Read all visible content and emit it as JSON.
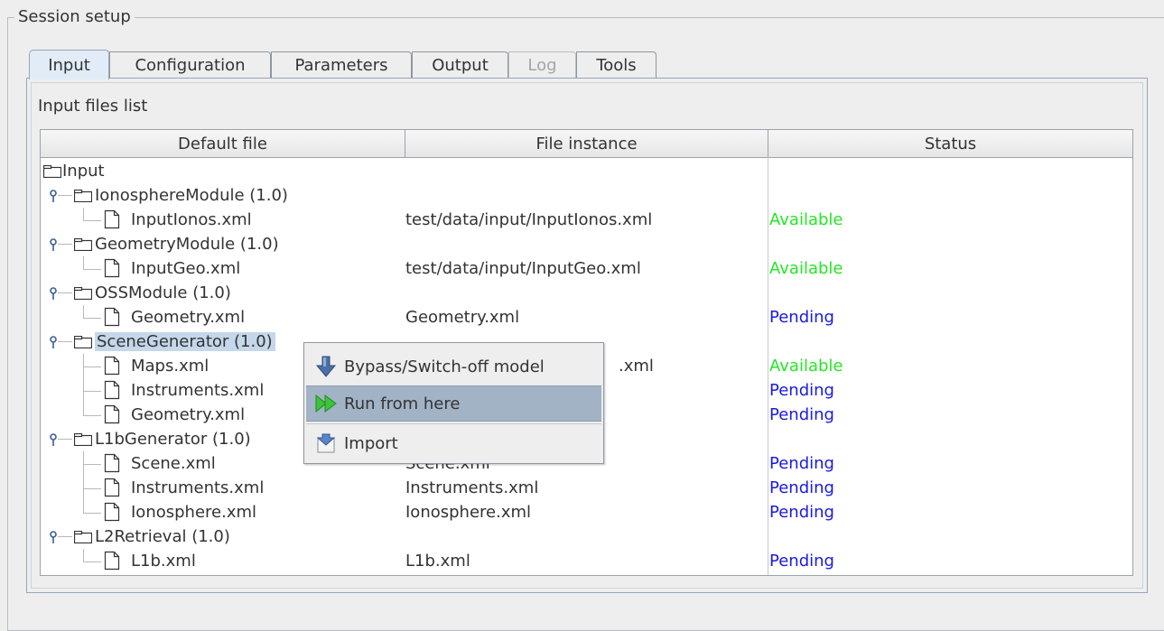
{
  "group": {
    "title": "Session setup"
  },
  "tabs": [
    {
      "label": "Input",
      "selected": true,
      "enabled": true
    },
    {
      "label": "Configuration",
      "selected": false,
      "enabled": true
    },
    {
      "label": "Parameters",
      "selected": false,
      "enabled": true
    },
    {
      "label": "Output",
      "selected": false,
      "enabled": true
    },
    {
      "label": "Log",
      "selected": false,
      "enabled": false
    },
    {
      "label": "Tools",
      "selected": false,
      "enabled": true
    }
  ],
  "input_panel": {
    "label": "Input files list",
    "columns": [
      "Default file",
      "File instance",
      "Status"
    ],
    "status_colors": {
      "Available": "#26e526",
      "Pending": "#1a1ae0"
    },
    "rows": [
      {
        "kind": "root",
        "file": "Input",
        "instance": "",
        "status": ""
      },
      {
        "kind": "module",
        "file": "IonosphereModule (1.0)",
        "instance": "",
        "status": ""
      },
      {
        "kind": "file",
        "file": "InputIonos.xml",
        "instance": "test/data/input/InputIonos.xml",
        "status": "Available"
      },
      {
        "kind": "module",
        "file": "GeometryModule (1.0)",
        "instance": "",
        "status": ""
      },
      {
        "kind": "file",
        "file": "InputGeo.xml",
        "instance": "test/data/input/InputGeo.xml",
        "status": "Available"
      },
      {
        "kind": "module",
        "file": "OSSModule (1.0)",
        "instance": "",
        "status": ""
      },
      {
        "kind": "file",
        "file": "Geometry.xml",
        "instance": "Geometry.xml",
        "status": "Pending"
      },
      {
        "kind": "module",
        "file": "SceneGenerator (1.0)",
        "instance": "",
        "status": "",
        "selected": true
      },
      {
        "kind": "file",
        "file": "Maps.xml",
        "instance": ".xml",
        "status": "Available"
      },
      {
        "kind": "file",
        "file": "Instruments.xml",
        "instance": "",
        "status": "Pending"
      },
      {
        "kind": "file",
        "file": "Geometry.xml",
        "instance": "",
        "status": "Pending"
      },
      {
        "kind": "module",
        "file": "L1bGenerator (1.0)",
        "instance": "",
        "status": ""
      },
      {
        "kind": "file",
        "file": "Scene.xml",
        "instance": "Scene.xml",
        "status": "Pending"
      },
      {
        "kind": "file",
        "file": "Instruments.xml",
        "instance": "Instruments.xml",
        "status": "Pending"
      },
      {
        "kind": "file",
        "file": "Ionosphere.xml",
        "instance": "Ionosphere.xml",
        "status": "Pending"
      },
      {
        "kind": "module",
        "file": "L2Retrieval (1.0)",
        "instance": "",
        "status": ""
      },
      {
        "kind": "file",
        "file": "L1b.xml",
        "instance": "L1b.xml",
        "status": "Pending"
      }
    ]
  },
  "context_menu": {
    "items": [
      {
        "label": "Bypass/Switch-off model",
        "icon": "down-arrow-icon",
        "highlighted": false
      },
      {
        "label": "Run from here",
        "icon": "fast-forward-icon",
        "highlighted": true
      },
      {
        "label": "Import",
        "icon": "import-icon",
        "highlighted": false
      }
    ]
  }
}
